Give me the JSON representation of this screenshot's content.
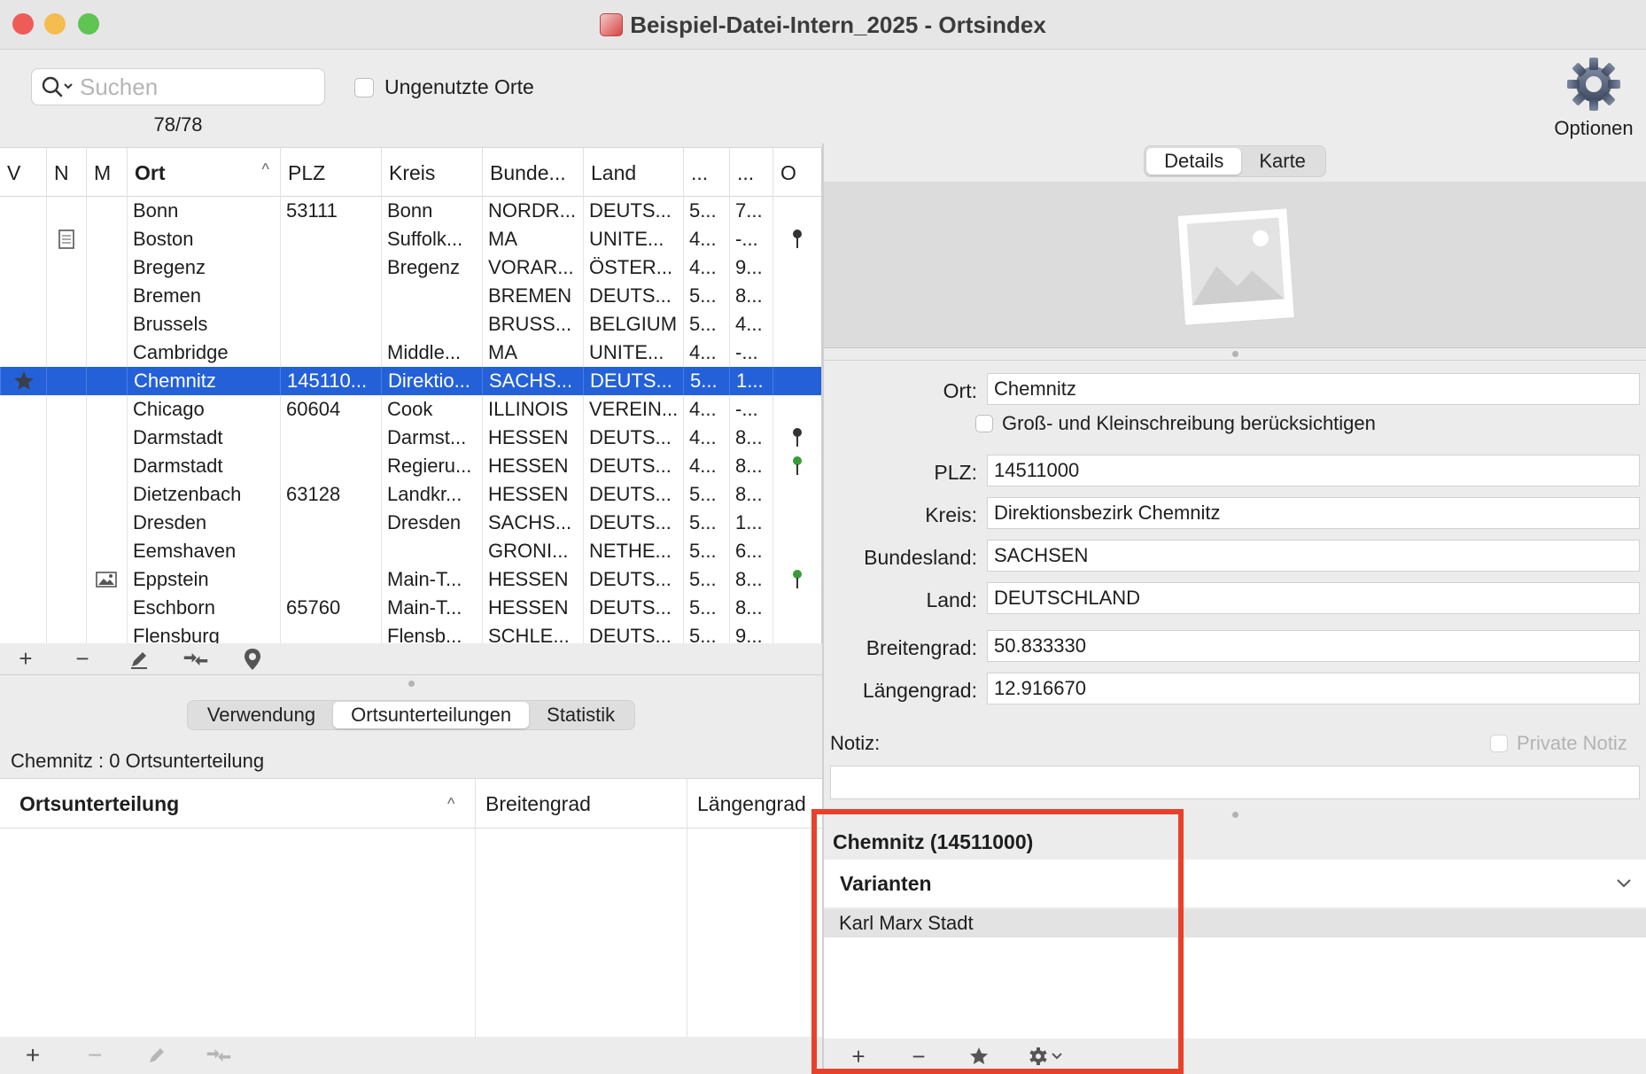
{
  "window": {
    "title": "Beispiel-Datei-Intern_2025 - Ortsindex",
    "traffic_lights": {
      "close": "#ee5c57",
      "minimize": "#f5bd4f",
      "zoom": "#5fc453"
    }
  },
  "toolbar": {
    "search_placeholder": "Suchen",
    "search_value": "",
    "counter": "78/78",
    "unused_label": "Ungenutzte Orte",
    "unused_checked": false,
    "options_label": "Optionen"
  },
  "table": {
    "columns": [
      "V",
      "N",
      "M",
      "Ort",
      "PLZ",
      "Kreis",
      "Bunde...",
      "Land",
      "...",
      "...",
      "O"
    ],
    "sort_column": "Ort",
    "rows": [
      {
        "v": "",
        "n": "",
        "m": "",
        "ort": "Bonn",
        "plz": "53111",
        "kreis": "Bonn",
        "bundesland": "NORDR...",
        "land": "DEUTS...",
        "c1": "5...",
        "c2": "7...",
        "o": ""
      },
      {
        "v": "",
        "n": "note-icon",
        "m": "",
        "ort": "Boston",
        "plz": "",
        "kreis": "Suffolk...",
        "bundesland": "MA",
        "land": "UNITE...",
        "c1": "4...",
        "c2": "-...",
        "o": "pin-dark"
      },
      {
        "v": "",
        "n": "",
        "m": "",
        "ort": "Bregenz",
        "plz": "",
        "kreis": "Bregenz",
        "bundesland": "VORAR...",
        "land": "ÖSTER...",
        "c1": "4...",
        "c2": "9...",
        "o": ""
      },
      {
        "v": "",
        "n": "",
        "m": "",
        "ort": "Bremen",
        "plz": "",
        "kreis": "",
        "bundesland": "BREMEN",
        "land": "DEUTS...",
        "c1": "5...",
        "c2": "8...",
        "o": ""
      },
      {
        "v": "",
        "n": "",
        "m": "",
        "ort": "Brussels",
        "plz": "",
        "kreis": "",
        "bundesland": "BRUSS...",
        "land": "BELGIUM",
        "c1": "5...",
        "c2": "4...",
        "o": ""
      },
      {
        "v": "",
        "n": "",
        "m": "",
        "ort": "Cambridge",
        "plz": "",
        "kreis": "Middle...",
        "bundesland": "MA",
        "land": "UNITE...",
        "c1": "4...",
        "c2": "-...",
        "o": ""
      },
      {
        "v": "star-icon",
        "n": "",
        "m": "",
        "ort": "Chemnitz",
        "plz": "145110...",
        "kreis": "Direktio...",
        "bundesland": "SACHS...",
        "land": "DEUTS...",
        "c1": "5...",
        "c2": "1...",
        "o": "",
        "selected": true
      },
      {
        "v": "",
        "n": "",
        "m": "",
        "ort": "Chicago",
        "plz": "60604",
        "kreis": "Cook",
        "bundesland": "ILLINOIS",
        "land": "VEREIN...",
        "c1": "4...",
        "c2": "-...",
        "o": ""
      },
      {
        "v": "",
        "n": "",
        "m": "",
        "ort": "Darmstadt",
        "plz": "",
        "kreis": "Darmst...",
        "bundesland": "HESSEN",
        "land": "DEUTS...",
        "c1": "4...",
        "c2": "8...",
        "o": "pin-dark"
      },
      {
        "v": "",
        "n": "",
        "m": "",
        "ort": "Darmstadt",
        "plz": "",
        "kreis": "Regieru...",
        "bundesland": "HESSEN",
        "land": "DEUTS...",
        "c1": "4...",
        "c2": "8...",
        "o": "pin-green"
      },
      {
        "v": "",
        "n": "",
        "m": "",
        "ort": "Dietzenbach",
        "plz": "63128",
        "kreis": "Landkr...",
        "bundesland": "HESSEN",
        "land": "DEUTS...",
        "c1": "5...",
        "c2": "8...",
        "o": ""
      },
      {
        "v": "",
        "n": "",
        "m": "",
        "ort": "Dresden",
        "plz": "",
        "kreis": "Dresden",
        "bundesland": "SACHS...",
        "land": "DEUTS...",
        "c1": "5...",
        "c2": "1...",
        "o": ""
      },
      {
        "v": "",
        "n": "",
        "m": "",
        "ort": "Eemshaven",
        "plz": "",
        "kreis": "",
        "bundesland": "GRONI...",
        "land": "NETHE...",
        "c1": "5...",
        "c2": "6...",
        "o": ""
      },
      {
        "v": "",
        "n": "",
        "m": "image-icon",
        "ort": "Eppstein",
        "plz": "",
        "kreis": "Main-T...",
        "bundesland": "HESSEN",
        "land": "DEUTS...",
        "c1": "5...",
        "c2": "8...",
        "o": "pin-green"
      },
      {
        "v": "",
        "n": "",
        "m": "",
        "ort": "Eschborn",
        "plz": "65760",
        "kreis": "Main-T...",
        "bundesland": "HESSEN",
        "land": "DEUTS...",
        "c1": "5...",
        "c2": "8...",
        "o": ""
      },
      {
        "v": "",
        "n": "",
        "m": "",
        "ort": "Flensburg",
        "plz": "",
        "kreis": "Flensb...",
        "bundesland": "SCHLE...",
        "land": "DEUTS...",
        "c1": "5...",
        "c2": "9...",
        "o": ""
      }
    ]
  },
  "lower_tabs": {
    "items": [
      "Verwendung",
      "Ortsunterteilungen",
      "Statistik"
    ],
    "active": "Ortsunterteilungen"
  },
  "subdivisions": {
    "summary": "Chemnitz : 0 Ortsunterteilung",
    "columns": [
      "Ortsunterteilung",
      "Breitengrad",
      "Längengrad"
    ]
  },
  "detail_tabs": {
    "items": [
      "Details",
      "Karte"
    ],
    "active": "Details"
  },
  "details": {
    "ort_label": "Ort:",
    "ort_value": "Chemnitz",
    "case_label": "Groß- und Kleinschreibung berücksichtigen",
    "plz_label": "PLZ:",
    "plz_value": "14511000",
    "kreis_label": "Kreis:",
    "kreis_value": "Direktionsbezirk Chemnitz",
    "bundesland_label": "Bundesland:",
    "bundesland_value": "SACHSEN",
    "land_label": "Land:",
    "land_value": "DEUTSCHLAND",
    "breitengrad_label": "Breitengrad:",
    "breitengrad_value": "50.833330",
    "laengengrad_label": "Längengrad:",
    "laengengrad_value": "12.916670",
    "notiz_label": "Notiz:",
    "private_label": "Private Notiz"
  },
  "variants": {
    "title": "Chemnitz (14511000)",
    "header": "Varianten",
    "items": [
      "Karl Marx Stadt"
    ]
  },
  "colors": {
    "selection": "#2461d8",
    "highlight_box": "#e8412b"
  }
}
